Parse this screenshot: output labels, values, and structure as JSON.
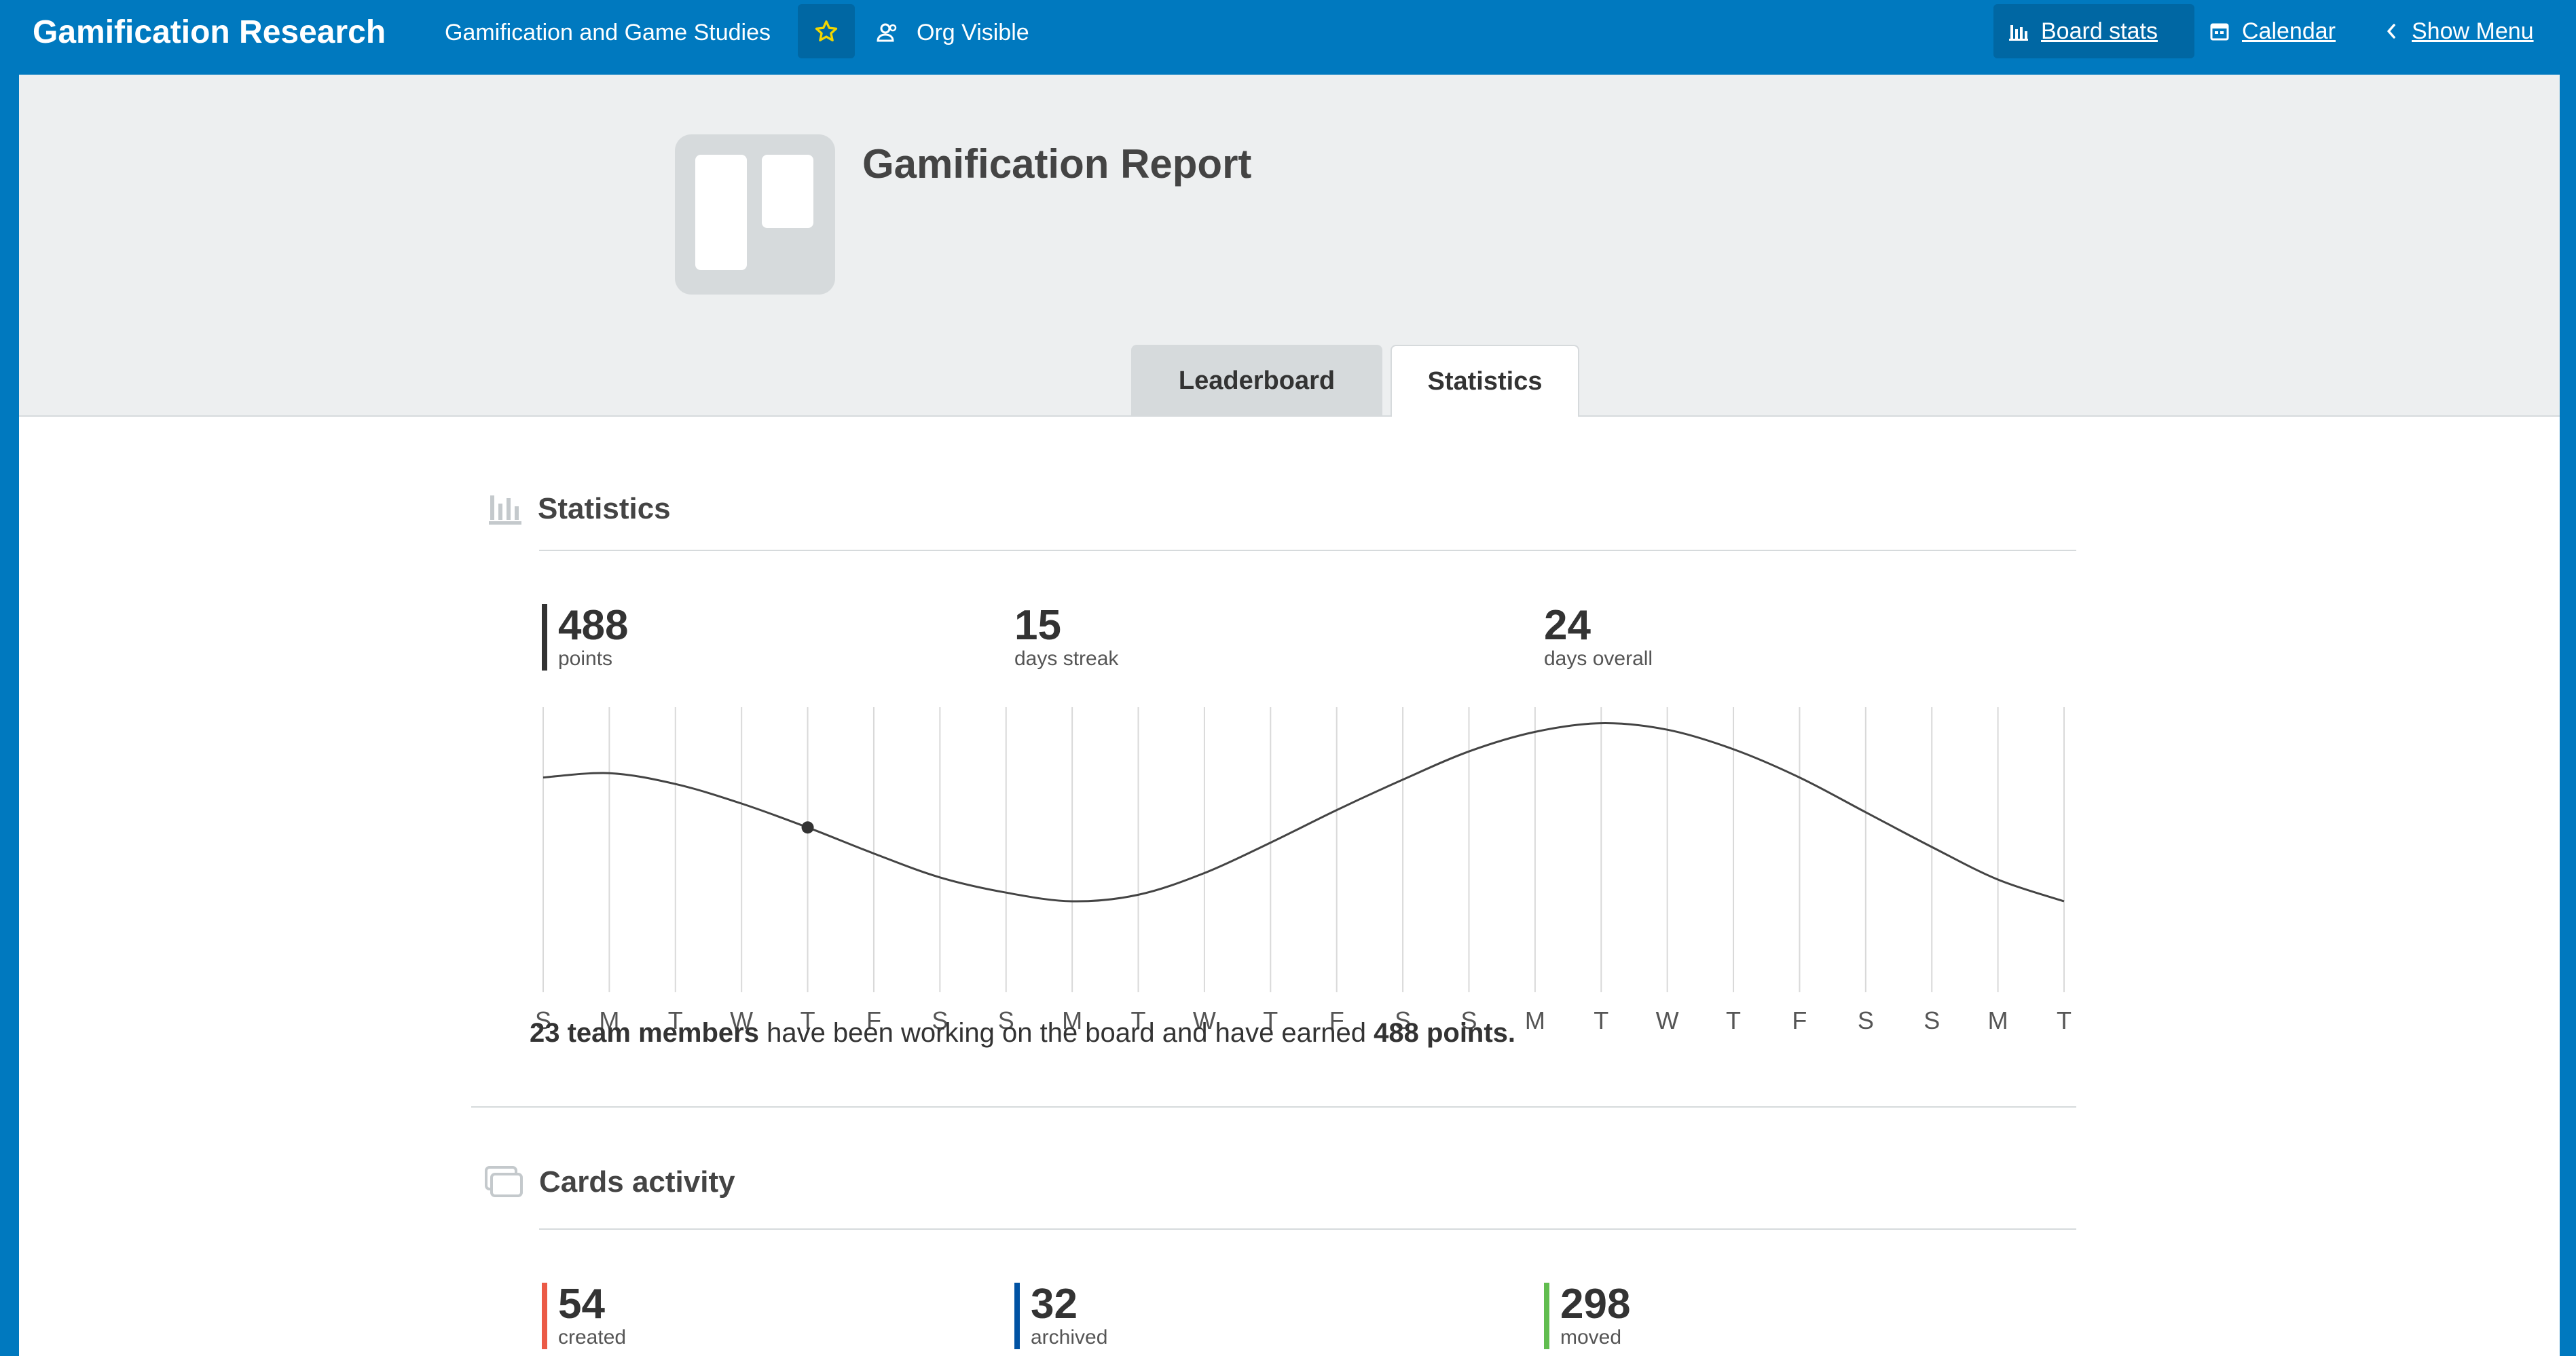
{
  "header": {
    "board_title": "Gamification Research",
    "team_name": "Gamification and Game Studies",
    "visibility_label": "Org Visible",
    "board_stats_label": "Board stats",
    "calendar_label": "Calendar",
    "show_menu_label": "Show Menu"
  },
  "report": {
    "title": "Gamification Report",
    "tabs": [
      {
        "label": "Leaderboard",
        "active": false
      },
      {
        "label": "Statistics",
        "active": true
      }
    ]
  },
  "statistics": {
    "section_title": "Statistics",
    "points_value": "488",
    "points_label": "points",
    "streak_value": "15",
    "streak_label": "days streak",
    "overall_value": "24",
    "overall_label": "days overall",
    "summary": {
      "members": "23 team members",
      "middle": " have been working on the board and have earned ",
      "points": "488 points."
    }
  },
  "chart_data": {
    "type": "line",
    "x": [
      "S",
      "M",
      "T",
      "W",
      "T",
      "F",
      "S",
      "S",
      "M",
      "T",
      "W",
      "T",
      "F",
      "S",
      "S",
      "M",
      "T",
      "W",
      "T",
      "F",
      "S",
      "S",
      "M",
      "T"
    ],
    "values": [
      0.67,
      0.69,
      0.64,
      0.55,
      0.44,
      0.32,
      0.21,
      0.14,
      0.1,
      0.13,
      0.23,
      0.37,
      0.52,
      0.66,
      0.79,
      0.88,
      0.92,
      0.89,
      0.8,
      0.67,
      0.51,
      0.35,
      0.2,
      0.1
    ],
    "highlighted_index": 4,
    "grid": true
  },
  "cards_activity": {
    "section_title": "Cards activity",
    "created_value": "54",
    "created_label": "created",
    "archived_value": "32",
    "archived_label": "archived",
    "moved_value": "298",
    "moved_label": "moved",
    "colors": {
      "created": "#eb5a46",
      "archived": "#0052a3",
      "moved": "#61bd4f"
    }
  },
  "colors": {
    "brand_blue": "#0079bf",
    "star_yellow": "#f2d600"
  },
  "icons": {
    "star": "star-icon",
    "org": "org-visible-icon",
    "bar_chart": "bar-chart-icon",
    "calendar": "calendar-icon",
    "chevron": "chevron-left-icon",
    "cards": "cards-icon"
  }
}
